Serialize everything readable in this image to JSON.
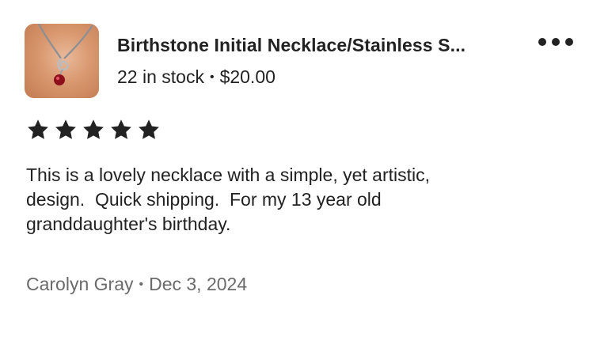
{
  "listing": {
    "title": "Birthstone Initial Necklace/Stainless S...",
    "stock": "22 in stock",
    "separator": "•",
    "price": "$20.00",
    "thumbnail_icon": "necklace-photo"
  },
  "menu": {
    "icon": "more-options-icon"
  },
  "review": {
    "rating": 5,
    "rating_max": 5,
    "star_color": "#222222",
    "text": "This is a lovely necklace with a simple, yet artistic,\ndesign.  Quick shipping.  For my 13 year old\ngranddaughter's birthday.",
    "author": "Carolyn Gray",
    "separator": "•",
    "date": "Dec 3, 2024"
  }
}
